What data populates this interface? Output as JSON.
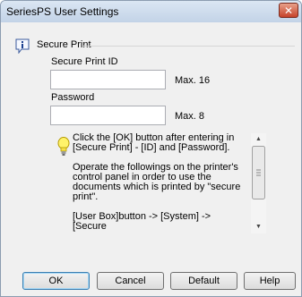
{
  "window": {
    "title": "SeriesPS User Settings",
    "close_glyph": "✕"
  },
  "icons": {
    "info": "info-icon",
    "hint": "lightbulb-icon"
  },
  "group": {
    "title": "Secure Print"
  },
  "secure_print_id": {
    "label": "Secure Print ID",
    "value": "",
    "max_label": "Max. 16"
  },
  "password": {
    "label": "Password",
    "value": "",
    "max_label": "Max. 8"
  },
  "hint": {
    "paragraph1": "Click the [OK] button after entering in [Secure Print] - [ID] and [Password].",
    "paragraph2": "Operate the followings on the printer's control panel in order to use the documents which is printed by \"secure print\".",
    "paragraph3": "[User Box]button -> [System] -> [Secure"
  },
  "buttons": {
    "ok": "OK",
    "cancel": "Cancel",
    "default": "Default",
    "help": "Help"
  },
  "colors": {
    "titlebar": "#c3d3e7",
    "close": "#c6432b",
    "dialog_bg": "#f0f0f0"
  }
}
